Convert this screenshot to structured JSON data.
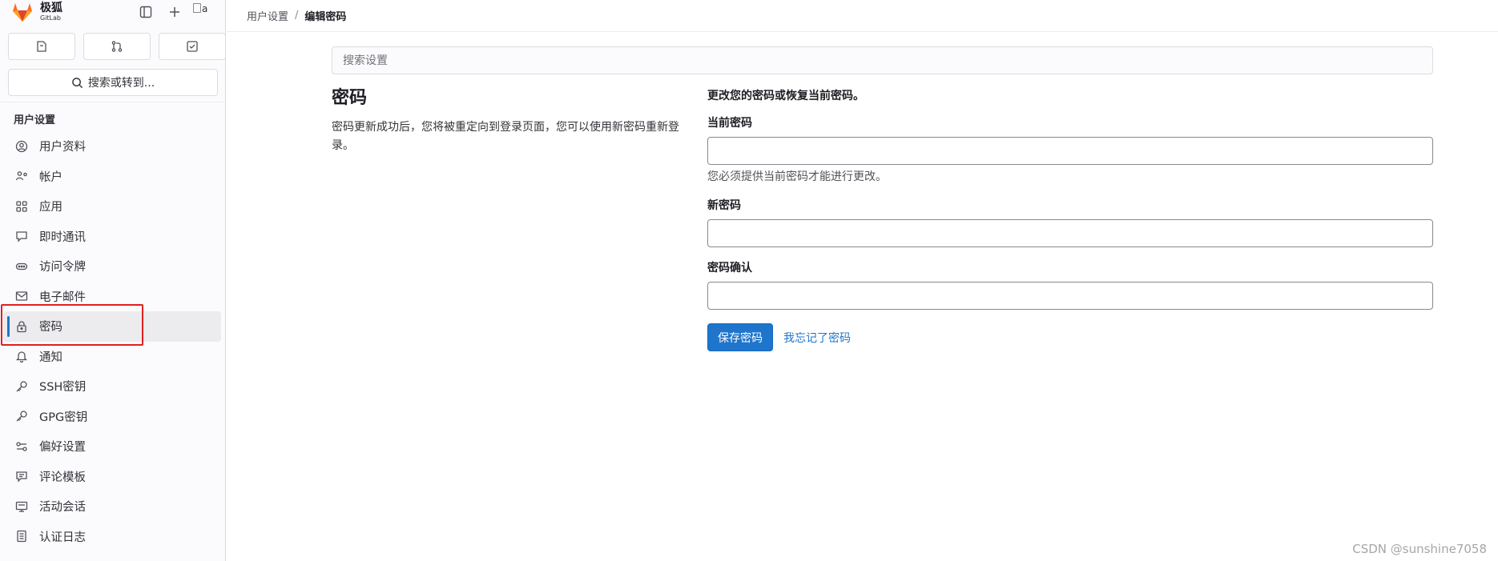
{
  "brand": {
    "name": "极狐",
    "sub": "GitLab",
    "accent": "#e24329"
  },
  "sidebar": {
    "search_label": "搜索或转到...",
    "section_title": "用户设置",
    "items": [
      {
        "label": "用户资料",
        "icon": "profile-icon"
      },
      {
        "label": "帐户",
        "icon": "account-icon"
      },
      {
        "label": "应用",
        "icon": "applications-icon"
      },
      {
        "label": "即时通讯",
        "icon": "chat-icon"
      },
      {
        "label": "访问令牌",
        "icon": "token-icon"
      },
      {
        "label": "电子邮件",
        "icon": "mail-icon"
      },
      {
        "label": "密码",
        "icon": "lock-icon",
        "active": true
      },
      {
        "label": "通知",
        "icon": "bell-icon"
      },
      {
        "label": "SSH密钥",
        "icon": "key-icon"
      },
      {
        "label": "GPG密钥",
        "icon": "key-icon"
      },
      {
        "label": "偏好设置",
        "icon": "preferences-icon"
      },
      {
        "label": "评论模板",
        "icon": "comment-template-icon"
      },
      {
        "label": "活动会话",
        "icon": "sessions-icon"
      },
      {
        "label": "认证日志",
        "icon": "log-icon"
      }
    ]
  },
  "breadcrumb": {
    "parent": "用户设置",
    "sep": "/",
    "current": "编辑密码"
  },
  "search": {
    "placeholder": "搜索设置"
  },
  "section": {
    "title": "密码",
    "description": "密码更新成功后，您将被重定向到登录页面，您可以使用新密码重新登录。"
  },
  "form": {
    "intro": "更改您的密码或恢复当前密码。",
    "current_label": "当前密码",
    "current_help": "您必须提供当前密码才能进行更改。",
    "new_label": "新密码",
    "confirm_label": "密码确认",
    "save_label": "保存密码",
    "forgot_label": "我忘记了密码"
  },
  "watermark": "CSDN @sunshine7058",
  "colors": {
    "primary": "#1f75cb",
    "highlight_border": "#e02020"
  }
}
